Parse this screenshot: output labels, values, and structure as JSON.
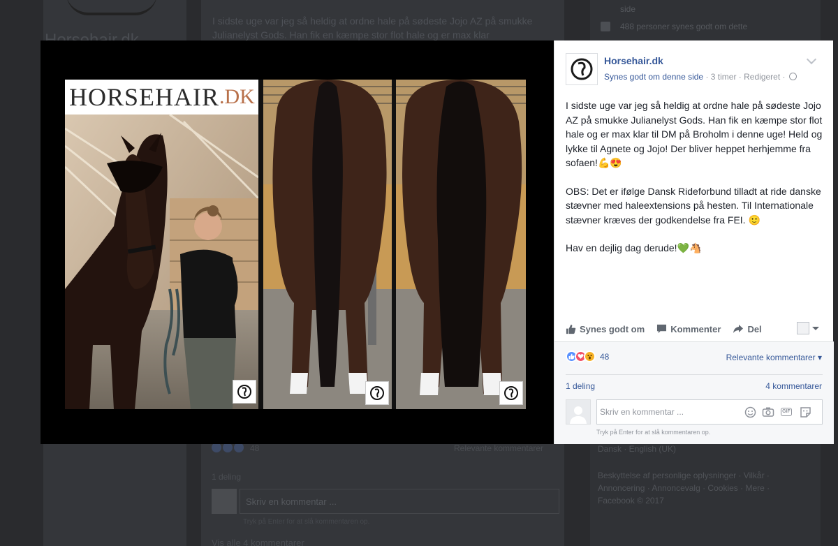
{
  "background": {
    "page_name": "Horsehair.dk",
    "post_text": "I sidste uge var jeg så heldig at ordne hale på sødeste Jojo AZ på smukke Julianelyst Gods. Han fik en kæmpe stor flot hale og er max klar",
    "right_line": "side",
    "right_likes": "488 personer synes godt om dette",
    "reaction_count": "48",
    "relevant": "Relevante kommentarer",
    "shares": "1 deling",
    "comment_placeholder": "Skriv en kommentar ...",
    "enter_hint": "Tryk på Enter for at slå kommentaren op.",
    "more_comments": "Vis alle 4 kommentarer",
    "language": "Dansk · English (UK)",
    "footer": "Beskyttelse af personlige oplysninger · Vilkår · Annoncering · Annoncevalg · Cookies · Mere · Facebook © 2017"
  },
  "photo": {
    "brand_main": "HORSEHAIR",
    "brand_dk": ".DK",
    "colors": {
      "stage": "#000000",
      "brand_accent": "#b8704a"
    }
  },
  "post": {
    "page_name": "Horsehair.dk",
    "like_link": "Synes godt om denne side",
    "time": "3 timer",
    "edited": "Redigeret",
    "separator": " · ",
    "paragraph_1": "I sidste uge var jeg så heldig at ordne hale på sødeste Jojo AZ på smukke Julianelyst Gods. Han fik en kæmpe stor flot hale og er max klar til DM på Broholm i denne uge! Held og lykke til Agnete og Jojo! Der bliver heppet herhjemme fra sofaen!",
    "paragraph_1_emoji": "💪😍",
    "paragraph_2": "OBS: Det er ifølge Dansk Rideforbund tilladt at ride danske stævner med haleextensions på hesten. Til Internationale stævner kræves der godkendelse fra FEI.",
    "paragraph_2_emoji": "🙂",
    "paragraph_3": "Hav en dejlig dag derude!",
    "paragraph_3_emoji": "💚🐴",
    "actions": {
      "like": "Synes godt om",
      "comment": "Kommenter",
      "share": "Del"
    },
    "reaction_count": "48",
    "relevant_comments": "Relevante kommentarer",
    "shares": "1 deling",
    "comments": "4 kommentarer",
    "comment_placeholder": "Skriv en kommentar ...",
    "enter_hint": "Tryk på Enter for at slå kommentaren op.",
    "icons": [
      "like-icon",
      "comment-icon",
      "share-icon",
      "emoji-icon",
      "camera-icon",
      "gif-icon",
      "sticker-icon",
      "globe-icon",
      "chevron-down-icon"
    ],
    "colors": {
      "link": "#365899",
      "meta": "#90949c",
      "like": "#5890ff",
      "love": "#f25268",
      "wow": "#f7b125"
    }
  }
}
